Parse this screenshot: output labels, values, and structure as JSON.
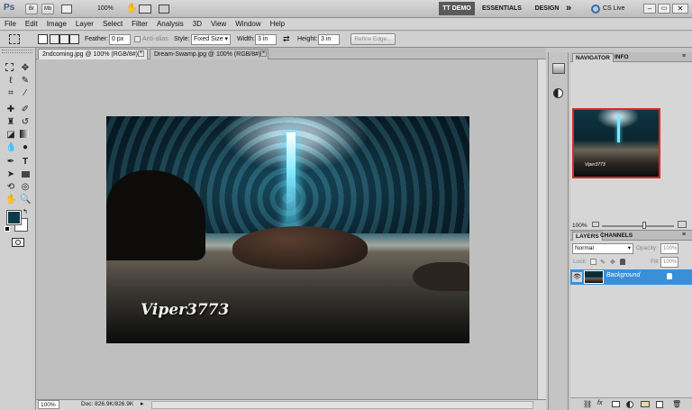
{
  "appbar": {
    "logo": "Ps",
    "zoom": "100%",
    "workspaces": [
      "TT DEMO",
      "ESSENTIALS",
      "DESIGN"
    ],
    "more": "»",
    "cs_live": "CS Live"
  },
  "menu": [
    "File",
    "Edit",
    "Image",
    "Layer",
    "Select",
    "Filter",
    "Analysis",
    "3D",
    "View",
    "Window",
    "Help"
  ],
  "options": {
    "feather_label": "Feather:",
    "feather_value": "0 px",
    "antialias_label": "Anti-alias",
    "style_label": "Style:",
    "style_value": "Fixed Size",
    "width_label": "Width:",
    "width_value": "3 in",
    "height_label": "Height:",
    "height_value": "3 in",
    "refine_edge": "Refine Edge..."
  },
  "documents": [
    {
      "title": "2ndcoming.jpg @ 100% (RGB/8#)",
      "active": true
    },
    {
      "title": "Dream-Swamp.jpg @ 100% (RGB/8#)",
      "active": false
    }
  ],
  "canvas": {
    "watermark": "Viper3773"
  },
  "status": {
    "zoom": "100%",
    "doc": "Doc: 826.9K/826.9K"
  },
  "navigator": {
    "tabs": [
      "NAVIGATOR",
      "INFO"
    ],
    "zoom": "100%",
    "thumb_watermark": "Viper3773"
  },
  "layers": {
    "tabs": [
      "LAYERS",
      "CHANNELS"
    ],
    "blend_mode": "Normal",
    "opacity_label": "Opacity:",
    "opacity_value": "100%",
    "lock_label": "Lock:",
    "fill_label": "Fill:",
    "fill_value": "100%",
    "items": [
      {
        "name": "Background"
      }
    ]
  },
  "colors": {
    "foreground": "#0f3a4a",
    "background": "#ffffff",
    "layer_selected": "#3b8fd8"
  }
}
